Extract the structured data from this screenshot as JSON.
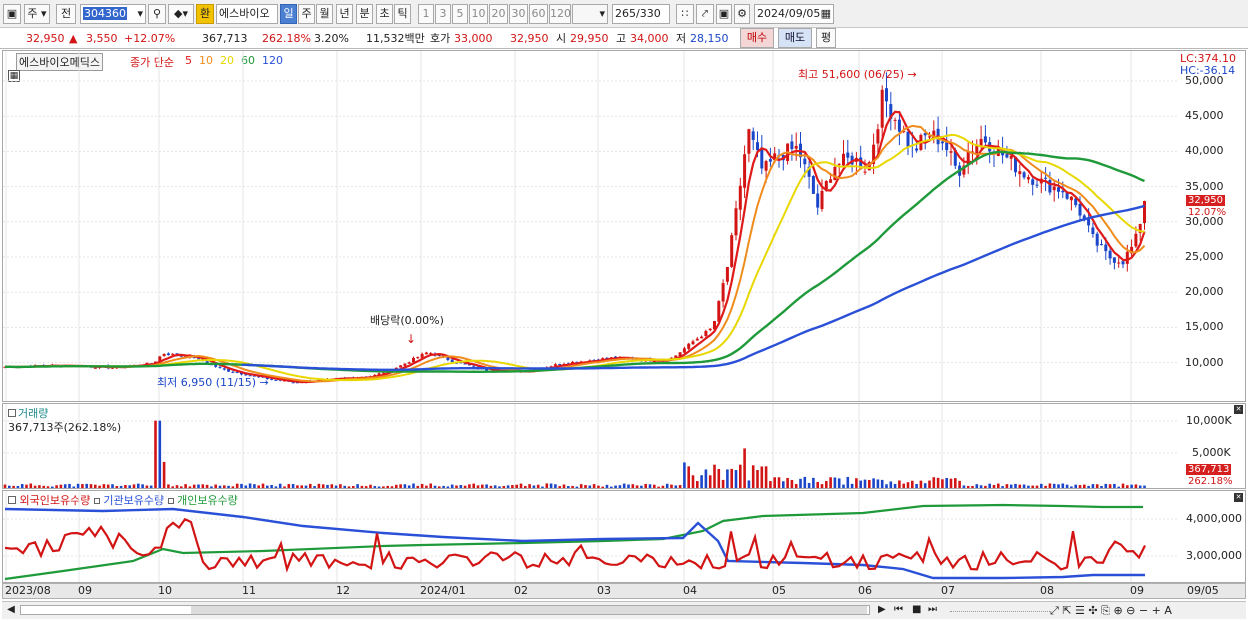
{
  "toolbar": {
    "market_label": "주",
    "prev_label": "전",
    "code": "304360",
    "hwan": "환",
    "stock_name": "에스바이오",
    "periods": [
      "일",
      "주",
      "월",
      "년",
      "분",
      "초",
      "틱"
    ],
    "selected_period": "일",
    "minute_opts": [
      "1",
      "3",
      "5",
      "10",
      "20",
      "30",
      "60",
      "120"
    ],
    "count": "265",
    "total": "/330",
    "date": "2024/09/05"
  },
  "quote": {
    "price": "32,950",
    "change": "3,550",
    "change_pct": "+12.07%",
    "volume": "367,713",
    "vol_ratio": "262.18%",
    "turnover": "3.20%",
    "amount": "11,532백만",
    "hoga_label": "호가",
    "hoga1": "33,000",
    "hoga2": "32,950",
    "open_label": "시",
    "open": "29,950",
    "high_label": "고",
    "high": "34,000",
    "low_label": "저",
    "low": "28,150",
    "buy": "매수",
    "sell": "매도",
    "pyeong": "평"
  },
  "price_pane": {
    "stock_name": "에스바이오메딕스",
    "legend_prefix": "종가 단순",
    "ma": [
      {
        "label": "5",
        "color": "#e01919"
      },
      {
        "label": "10",
        "color": "#f08c1c"
      },
      {
        "label": "20",
        "color": "#e8d800"
      },
      {
        "label": "60",
        "color": "#1f9a3a"
      },
      {
        "label": "120",
        "color": "#2a50d8"
      }
    ],
    "lc": "LC:374.10",
    "hc": "HC:-36.14",
    "y_ticks": [
      "50,000",
      "45,000",
      "40,000",
      "35,000",
      "30,000",
      "25,000",
      "20,000",
      "15,000",
      "10,000"
    ],
    "y_tick_values": [
      50000,
      45000,
      40000,
      35000,
      30000,
      25000,
      20000,
      15000,
      10000
    ],
    "last_price_tag": "32,950",
    "last_pct_tag": "12.07%",
    "high_note": "최고 51,600 (06/25)",
    "low_note": "최저 6,950 (11/15)",
    "dividend_note": "배당락(0.00%)"
  },
  "volume_pane": {
    "title": "거래량",
    "current": "367,713주(262.18%)",
    "y_ticks": [
      "10,000K",
      "5,000K"
    ],
    "tag_value": "367,713",
    "tag_pct": "262.18%"
  },
  "holdings_pane": {
    "foreign": "외국인보유수량",
    "institution": "기관보유수량",
    "individual": "개인보유수량",
    "y_ticks": [
      "4,000,000",
      "3,000,000"
    ]
  },
  "x_axis": [
    "2023/08",
    "09",
    "10",
    "11",
    "12",
    "2024/01",
    "02",
    "03",
    "04",
    "05",
    "06",
    "07",
    "08",
    "09",
    "09/05"
  ],
  "colors": {
    "up": "#d21414",
    "down": "#1b46c9",
    "foreign": "#d21414",
    "institution": "#2a50d8",
    "individual": "#1f9a3a"
  }
}
